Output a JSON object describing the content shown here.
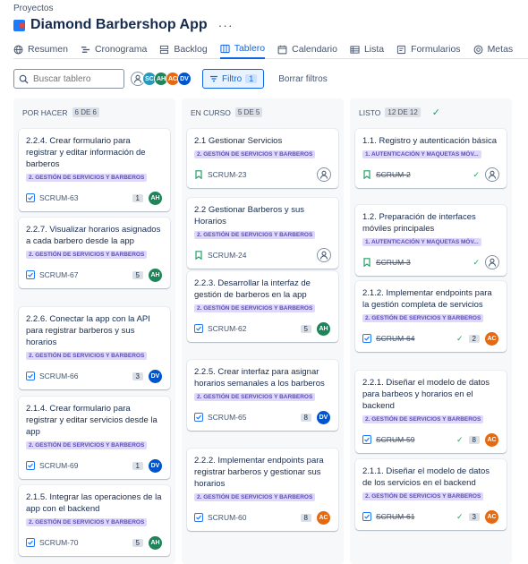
{
  "breadcrumb": "Proyectos",
  "project_title": "Diamond Barbershop App",
  "more": "···",
  "tabs": [
    {
      "label": "Resumen",
      "icon": "globe-icon"
    },
    {
      "label": "Cronograma",
      "icon": "timeline-icon"
    },
    {
      "label": "Backlog",
      "icon": "backlog-icon"
    },
    {
      "label": "Tablero",
      "icon": "board-icon",
      "active": true
    },
    {
      "label": "Calendario",
      "icon": "calendar-icon"
    },
    {
      "label": "Lista",
      "icon": "list-icon"
    },
    {
      "label": "Formularios",
      "icon": "forms-icon"
    },
    {
      "label": "Metas",
      "icon": "target-icon"
    }
  ],
  "toolbar": {
    "search_placeholder": "Buscar tablero",
    "avatars": [
      {
        "initials": "",
        "color": "#ffffff",
        "icon": "user-icon"
      },
      {
        "initials": "SC",
        "color": "#2898bd"
      },
      {
        "initials": "AH",
        "color": "#1f845a"
      },
      {
        "initials": "AC",
        "color": "#e56910"
      },
      {
        "initials": "DV",
        "color": "#0055cc"
      }
    ],
    "filter_label": "Filtro",
    "filter_count": "1",
    "clear_label": "Borrar filtros"
  },
  "columns": [
    {
      "name": "POR HACER",
      "count": "6 DE 6",
      "cards": [
        {
          "title": "2.2.4. Crear formulario para registrar y editar información de barberos",
          "label": "2. GESTIÓN DE SERVICIOS Y BARBEROS",
          "key": "SCRUM-63",
          "type": "task",
          "estimate": "1",
          "assignee": "AH",
          "assignee_color": "#1f845a"
        },
        {
          "title": "2.2.7. Visualizar horarios asignados a cada barbero desde la app",
          "label": "2. GESTIÓN DE SERVICIOS Y BARBEROS",
          "key": "SCRUM-67",
          "type": "task",
          "estimate": "5",
          "assignee": "AH",
          "assignee_color": "#1f845a"
        },
        {
          "title": "2.2.6. Conectar la app con la API para registrar barberos y sus horarios",
          "label": "2. GESTIÓN DE SERVICIOS Y BARBEROS",
          "key": "SCRUM-66",
          "type": "task",
          "estimate": "3",
          "assignee": "DV",
          "assignee_color": "#0055cc"
        },
        {
          "title": "2.1.4. Crear formulario para registrar y editar servicios desde la app",
          "label": "2. GESTIÓN DE SERVICIOS Y BARBEROS",
          "key": "SCRUM-69",
          "type": "task",
          "estimate": "1",
          "assignee": "DV",
          "assignee_color": "#0055cc"
        },
        {
          "title": "2.1.5. Integrar las operaciones de la app con el backend",
          "label": "2. GESTIÓN DE SERVICIOS Y BARBEROS",
          "key": "SCRUM-70",
          "type": "task",
          "estimate": "5",
          "assignee": "AH",
          "assignee_color": "#1f845a"
        }
      ]
    },
    {
      "name": "EN CURSO",
      "count": "5 DE 5",
      "cards": [
        {
          "title": "2.1 Gestionar Servicios",
          "label": "2. GESTIÓN DE SERVICIOS Y BARBEROS",
          "key": "SCRUM-23",
          "type": "story",
          "estimate": "",
          "assignee": "",
          "assignee_color": ""
        },
        {
          "title": "2.2 Gestionar Barberos y sus Horarios",
          "label": "2. GESTIÓN DE SERVICIOS Y BARBEROS",
          "key": "SCRUM-24",
          "type": "story",
          "estimate": "",
          "assignee": "",
          "assignee_color": ""
        },
        {
          "title": "2.2.3. Desarrollar la interfaz de gestión de barberos en la app",
          "label": "2. GESTIÓN DE SERVICIOS Y BARBEROS",
          "key": "SCRUM-62",
          "type": "task",
          "estimate": "5",
          "assignee": "AH",
          "assignee_color": "#1f845a"
        },
        {
          "title": "2.2.5. Crear interfaz para asignar horarios semanales a los barberos",
          "label": "2. GESTIÓN DE SERVICIOS Y BARBEROS",
          "key": "SCRUM-65",
          "type": "task",
          "estimate": "8",
          "assignee": "DV",
          "assignee_color": "#0055cc"
        },
        {
          "title": "2.2.2. Implementar endpoints para registrar barberos y gestionar sus horarios",
          "label": "2. GESTIÓN DE SERVICIOS Y BARBEROS",
          "key": "SCRUM-60",
          "type": "task",
          "estimate": "8",
          "assignee": "AC",
          "assignee_color": "#e56910"
        }
      ]
    },
    {
      "name": "LISTO",
      "count": "12 DE 12",
      "done": true,
      "cards": [
        {
          "title": "1.1. Registro y autenticación básica",
          "label": "1. AUTENTICACIÓN Y MAQUETAS MÓV...",
          "key": "SCRUM-2",
          "type": "story",
          "estimate": "",
          "assignee": "",
          "assignee_color": "",
          "done": true
        },
        {
          "title": "1.2. Preparación de interfaces móviles principales",
          "label": "1. AUTENTICACIÓN Y MAQUETAS MÓV...",
          "key": "SCRUM-3",
          "type": "story",
          "estimate": "",
          "assignee": "",
          "assignee_color": "",
          "done": true
        },
        {
          "title": "2.1.2. Implementar endpoints para la gestión completa de servicios",
          "label": "2. GESTIÓN DE SERVICIOS Y BARBEROS",
          "key": "SCRUM-64",
          "type": "task",
          "estimate": "2",
          "assignee": "AC",
          "assignee_color": "#e56910",
          "done": true
        },
        {
          "title": "2.2.1. Diseñar el modelo de datos para barbeos y horarios en el backend",
          "label": "2. GESTIÓN DE SERVICIOS Y BARBEROS",
          "key": "SCRUM-59",
          "type": "task",
          "estimate": "8",
          "assignee": "AC",
          "assignee_color": "#e56910",
          "done": true
        },
        {
          "title": "2.1.1. Diseñar el modelo de datos de los servicios en el backend",
          "label": "2. GESTIÓN DE SERVICIOS Y BARBEROS",
          "key": "SCRUM-61",
          "type": "task",
          "estimate": "3",
          "assignee": "AC",
          "assignee_color": "#e56910",
          "done": true
        }
      ]
    }
  ]
}
